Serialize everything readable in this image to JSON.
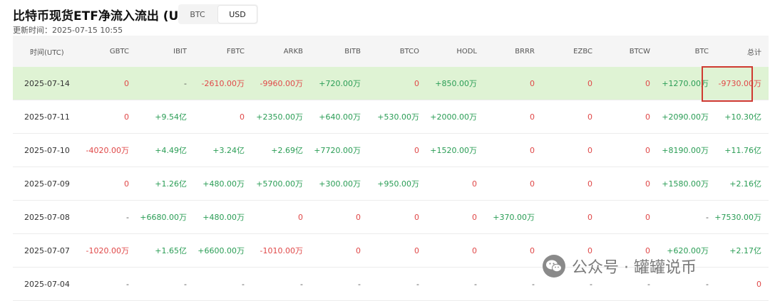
{
  "header": {
    "title": "比特币现货ETF净流入流出 (USD)",
    "updated": "更新时间：2025-07-15 10:55",
    "toggle": [
      {
        "label": "BTC",
        "active": false
      },
      {
        "label": "USD",
        "active": true
      }
    ]
  },
  "table": {
    "columns": [
      "时间(UTC)",
      "GBTC",
      "IBIT",
      "FBTC",
      "ARKB",
      "BITB",
      "BTCO",
      "HODL",
      "BRRR",
      "EZBC",
      "BTCW",
      "BTC",
      "总计"
    ],
    "rows": [
      {
        "cells": [
          "2025-07-14",
          "0",
          "-",
          "-2610.00万",
          "-9960.00万",
          "+720.00万",
          "0",
          "+850.00万",
          "0",
          "0",
          "0",
          "+1270.00万",
          "-9730.00万"
        ],
        "highlight": true
      },
      {
        "cells": [
          "2025-07-11",
          "0",
          "+9.54亿",
          "0",
          "+2350.00万",
          "+640.00万",
          "+530.00万",
          "+2000.00万",
          "0",
          "0",
          "0",
          "+2090.00万",
          "+10.30亿"
        ],
        "highlight": false
      },
      {
        "cells": [
          "2025-07-10",
          "-4020.00万",
          "+4.49亿",
          "+3.24亿",
          "+2.69亿",
          "+7720.00万",
          "0",
          "+1520.00万",
          "0",
          "0",
          "0",
          "+8190.00万",
          "+11.76亿"
        ],
        "highlight": false
      },
      {
        "cells": [
          "2025-07-09",
          "0",
          "+1.26亿",
          "+480.00万",
          "+5700.00万",
          "+300.00万",
          "+950.00万",
          "0",
          "0",
          "0",
          "0",
          "+1580.00万",
          "+2.16亿"
        ],
        "highlight": false
      },
      {
        "cells": [
          "2025-07-08",
          "-",
          "+6680.00万",
          "+480.00万",
          "0",
          "0",
          "0",
          "0",
          "+370.00万",
          "0",
          "0",
          "-",
          "+7530.00万"
        ],
        "highlight": false
      },
      {
        "cells": [
          "2025-07-07",
          "-1020.00万",
          "+1.65亿",
          "+6600.00万",
          "-1010.00万",
          "0",
          "0",
          "0",
          "0",
          "0",
          "0",
          "+620.00万",
          "+2.17亿"
        ],
        "highlight": false
      },
      {
        "cells": [
          "2025-07-04",
          "-",
          "-",
          "-",
          "-",
          "-",
          "-",
          "-",
          "-",
          "-",
          "-",
          "-",
          "0"
        ],
        "highlight": false
      }
    ]
  },
  "watermark": {
    "text": "公众号 · 罐罐说币",
    "icon": "wechat-icon"
  },
  "colors": {
    "positive": "#2a9d55",
    "negative": "#e04848",
    "highlight_row": "#dff3d4",
    "mark_box": "#cf3a31"
  }
}
